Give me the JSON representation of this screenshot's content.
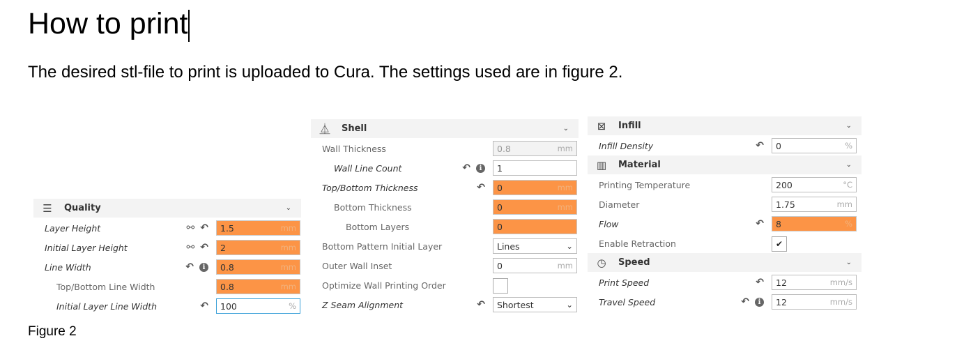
{
  "doc": {
    "title": "How to print",
    "paragraph": "The desired stl-file to print is uploaded to Cura. The settings used are in figure 2.",
    "caption": "Figure 2"
  },
  "colors": {
    "override": "#fc9446",
    "focus": "#3aa0d8"
  },
  "panels": [
    {
      "id": "quality",
      "sections": [
        {
          "title": "Quality",
          "icon": "quality-icon",
          "rows": [
            {
              "label": "Layer Height",
              "italic": true,
              "indent": 0,
              "icons": [
                "link",
                "reset"
              ],
              "value": "1.5",
              "unit": "mm",
              "state": "orange"
            },
            {
              "label": "Initial Layer Height",
              "italic": true,
              "indent": 0,
              "icons": [
                "link",
                "reset"
              ],
              "value": "2",
              "unit": "mm",
              "state": "orange"
            },
            {
              "label": "Line Width",
              "italic": true,
              "indent": 0,
              "icons": [
                "reset",
                "info"
              ],
              "value": "0.8",
              "unit": "mm",
              "state": "orange"
            },
            {
              "label": "Top/Bottom Line Width",
              "italic": false,
              "indent": 1,
              "icons": [],
              "value": "0.8",
              "unit": "mm",
              "state": "orange"
            },
            {
              "label": "Initial Layer Line Width",
              "italic": true,
              "indent": 1,
              "icons": [
                "reset"
              ],
              "value": "100",
              "unit": "%",
              "state": "focus"
            }
          ]
        }
      ]
    },
    {
      "id": "shell",
      "sections": [
        {
          "title": "Shell",
          "icon": "shell-icon",
          "rows": [
            {
              "label": "Wall Thickness",
              "italic": false,
              "indent": 0,
              "icons": [],
              "value": "0.8",
              "unit": "mm",
              "state": "disabled"
            },
            {
              "label": "Wall Line Count",
              "italic": true,
              "indent": 1,
              "icons": [
                "reset",
                "info"
              ],
              "value": "1",
              "unit": "",
              "state": "normal"
            },
            {
              "label": "Top/Bottom Thickness",
              "italic": true,
              "indent": 0,
              "icons": [
                "reset"
              ],
              "value": "0",
              "unit": "mm",
              "state": "orange"
            },
            {
              "label": "Bottom Thickness",
              "italic": false,
              "indent": 1,
              "icons": [],
              "value": "0",
              "unit": "mm",
              "state": "orange"
            },
            {
              "label": "Bottom Layers",
              "italic": false,
              "indent": 2,
              "icons": [],
              "value": "0",
              "unit": "",
              "state": "orange"
            },
            {
              "label": "Bottom Pattern Initial Layer",
              "italic": false,
              "indent": 0,
              "icons": [],
              "type": "select",
              "value": "Lines"
            },
            {
              "label": "Outer Wall Inset",
              "italic": false,
              "indent": 0,
              "icons": [],
              "value": "0",
              "unit": "mm",
              "state": "normal"
            },
            {
              "label": "Optimize Wall Printing Order",
              "italic": false,
              "indent": 0,
              "icons": [],
              "type": "checkbox",
              "checked": false
            },
            {
              "label": "Z Seam Alignment",
              "italic": true,
              "indent": 0,
              "icons": [
                "reset"
              ],
              "type": "select",
              "value": "Shortest"
            }
          ]
        }
      ]
    },
    {
      "id": "right",
      "sections": [
        {
          "title": "Infill",
          "icon": "infill-icon",
          "rows": [
            {
              "label": "Infill Density",
              "italic": true,
              "indent": 0,
              "icons": [
                "reset"
              ],
              "value": "0",
              "unit": "%",
              "state": "normal"
            }
          ]
        },
        {
          "title": "Material",
          "icon": "material-icon",
          "rows": [
            {
              "label": "Printing Temperature",
              "italic": false,
              "indent": 0,
              "icons": [],
              "value": "200",
              "unit": "°C",
              "state": "normal"
            },
            {
              "label": "Diameter",
              "italic": false,
              "indent": 0,
              "icons": [],
              "value": "1.75",
              "unit": "mm",
              "state": "normal"
            },
            {
              "label": "Flow",
              "italic": true,
              "indent": 0,
              "icons": [
                "reset"
              ],
              "value": "8",
              "unit": "%",
              "state": "orange"
            },
            {
              "label": "Enable Retraction",
              "italic": false,
              "indent": 0,
              "icons": [],
              "type": "checkbox",
              "checked": true
            }
          ]
        },
        {
          "title": "Speed",
          "icon": "speed-icon",
          "rows": [
            {
              "label": "Print Speed",
              "italic": true,
              "indent": 0,
              "icons": [
                "reset"
              ],
              "value": "12",
              "unit": "mm/s",
              "state": "normal"
            },
            {
              "label": "Travel Speed",
              "italic": true,
              "indent": 0,
              "icons": [
                "reset",
                "info"
              ],
              "value": "12",
              "unit": "mm/s",
              "state": "normal"
            }
          ]
        }
      ]
    }
  ]
}
